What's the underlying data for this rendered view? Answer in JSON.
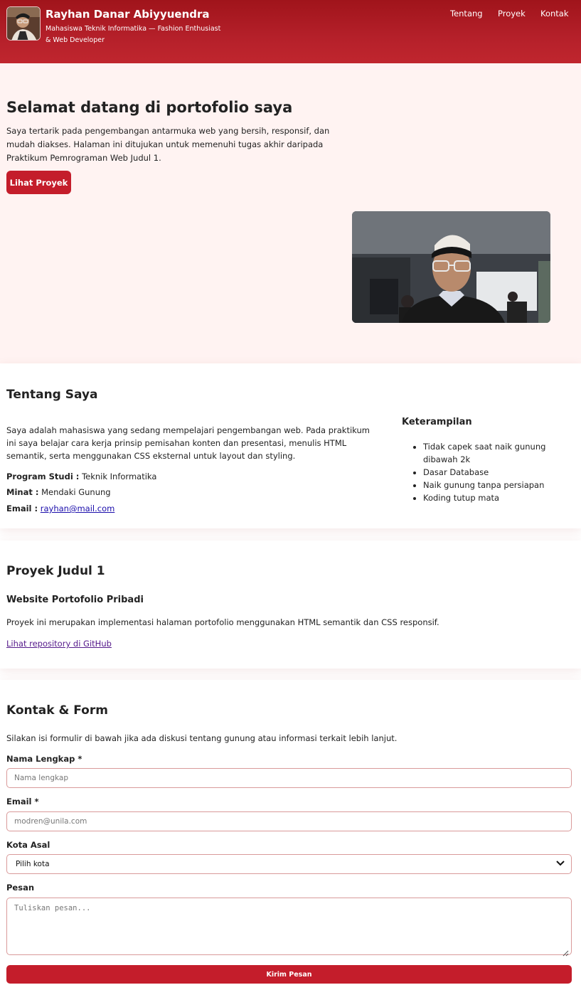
{
  "header": {
    "name": "Rayhan Danar Abiyyuendra",
    "tagline": "Mahasiswa Teknik Informatika — Fashion Enthusiast & Web Developer",
    "nav": [
      {
        "label": "Tentang"
      },
      {
        "label": "Proyek"
      },
      {
        "label": "Kontak"
      }
    ]
  },
  "hero": {
    "title": "Selamat datang di portofolio saya",
    "text": "Saya tertarik pada pengembangan antarmuka web yang bersih, responsif, dan mudah diakses. Halaman ini ditujukan untuk memenuhi tugas akhir daripada Praktikum Pemrograman Web Judul 1.",
    "button_label": "Lihat Proyek"
  },
  "about": {
    "title": "Tentang Saya",
    "text": "Saya adalah mahasiswa yang sedang mempelajari pengembangan web. Pada praktikum ini saya belajar cara kerja prinsip pemisahan konten dan presentasi, menulis HTML semantik, serta menggunakan CSS eksternal untuk layout dan styling.",
    "program_label": "Program Studi :",
    "program_value": "Teknik Informatika",
    "interest_label": "Minat :",
    "interest_value": "Mendaki Gunung",
    "email_label": "Email :",
    "email_value": "rayhan@mail.com",
    "skills_title": "Keterampilan",
    "skills": [
      "Tidak capek saat naik gunung dibawah 2k",
      "Dasar Database",
      "Naik gunung tanpa persiapan",
      "Koding tutup mata"
    ]
  },
  "project": {
    "title": "Proyek Judul 1",
    "subtitle": "Website Portofolio Pribadi",
    "description": "Proyek ini merupakan implementasi halaman portofolio menggunakan HTML semantik dan CSS responsif.",
    "link_label": "Lihat repository di GitHub"
  },
  "contact": {
    "title": "Kontak & Form",
    "intro": "Silakan isi formulir di bawah jika ada diskusi tentang gunung atau informasi terkait lebih lanjut.",
    "name_label": "Nama Lengkap *",
    "name_placeholder": "Nama lengkap",
    "email_label": "Email *",
    "email_placeholder": "modren@unila.com",
    "city_label": "Kota Asal",
    "city_selected": "Pilih kota",
    "message_label": "Pesan",
    "message_placeholder": "Tuliskan pesan...",
    "submit_label": "Kirim Pesan"
  },
  "colors": {
    "header": "#b01a22",
    "accent": "#c41d2b",
    "hero_bg": "#fff3f2",
    "field_border": "#d99a9a"
  }
}
